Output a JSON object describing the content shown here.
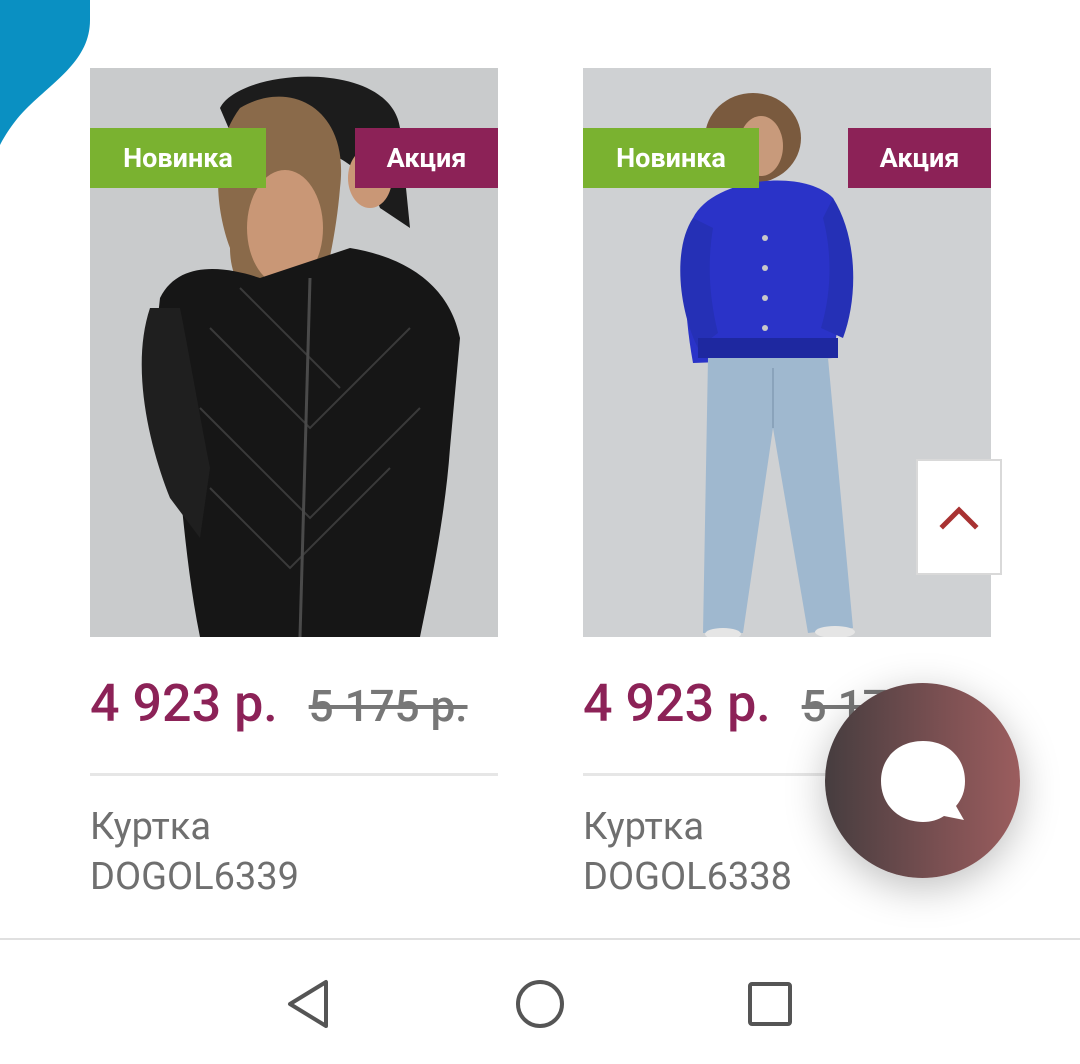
{
  "colors": {
    "accent_blue": "#0a90c2",
    "badge_new": "#7ab230",
    "badge_sale": "#8c2257",
    "price": "#8c2257",
    "old_price": "#777777",
    "chevron": "#a83232"
  },
  "products": [
    {
      "badge_new": "Новинка",
      "badge_sale": "Акция",
      "price_current": "4 923 р.",
      "price_old": "5 175 р.",
      "name": "Куртка",
      "code": "DOGOL6339"
    },
    {
      "badge_new": "Новинка",
      "badge_sale": "Акция",
      "price_current": "4 923 р.",
      "price_old": "5 175 р.",
      "name": "Куртка",
      "code": "DOGOL6338"
    }
  ],
  "icons": {
    "scroll_top": "chevron-up-icon",
    "chat": "chat-bubble-icon",
    "nav_back": "triangle-back-icon",
    "nav_home": "circle-home-icon",
    "nav_recents": "square-recents-icon"
  }
}
